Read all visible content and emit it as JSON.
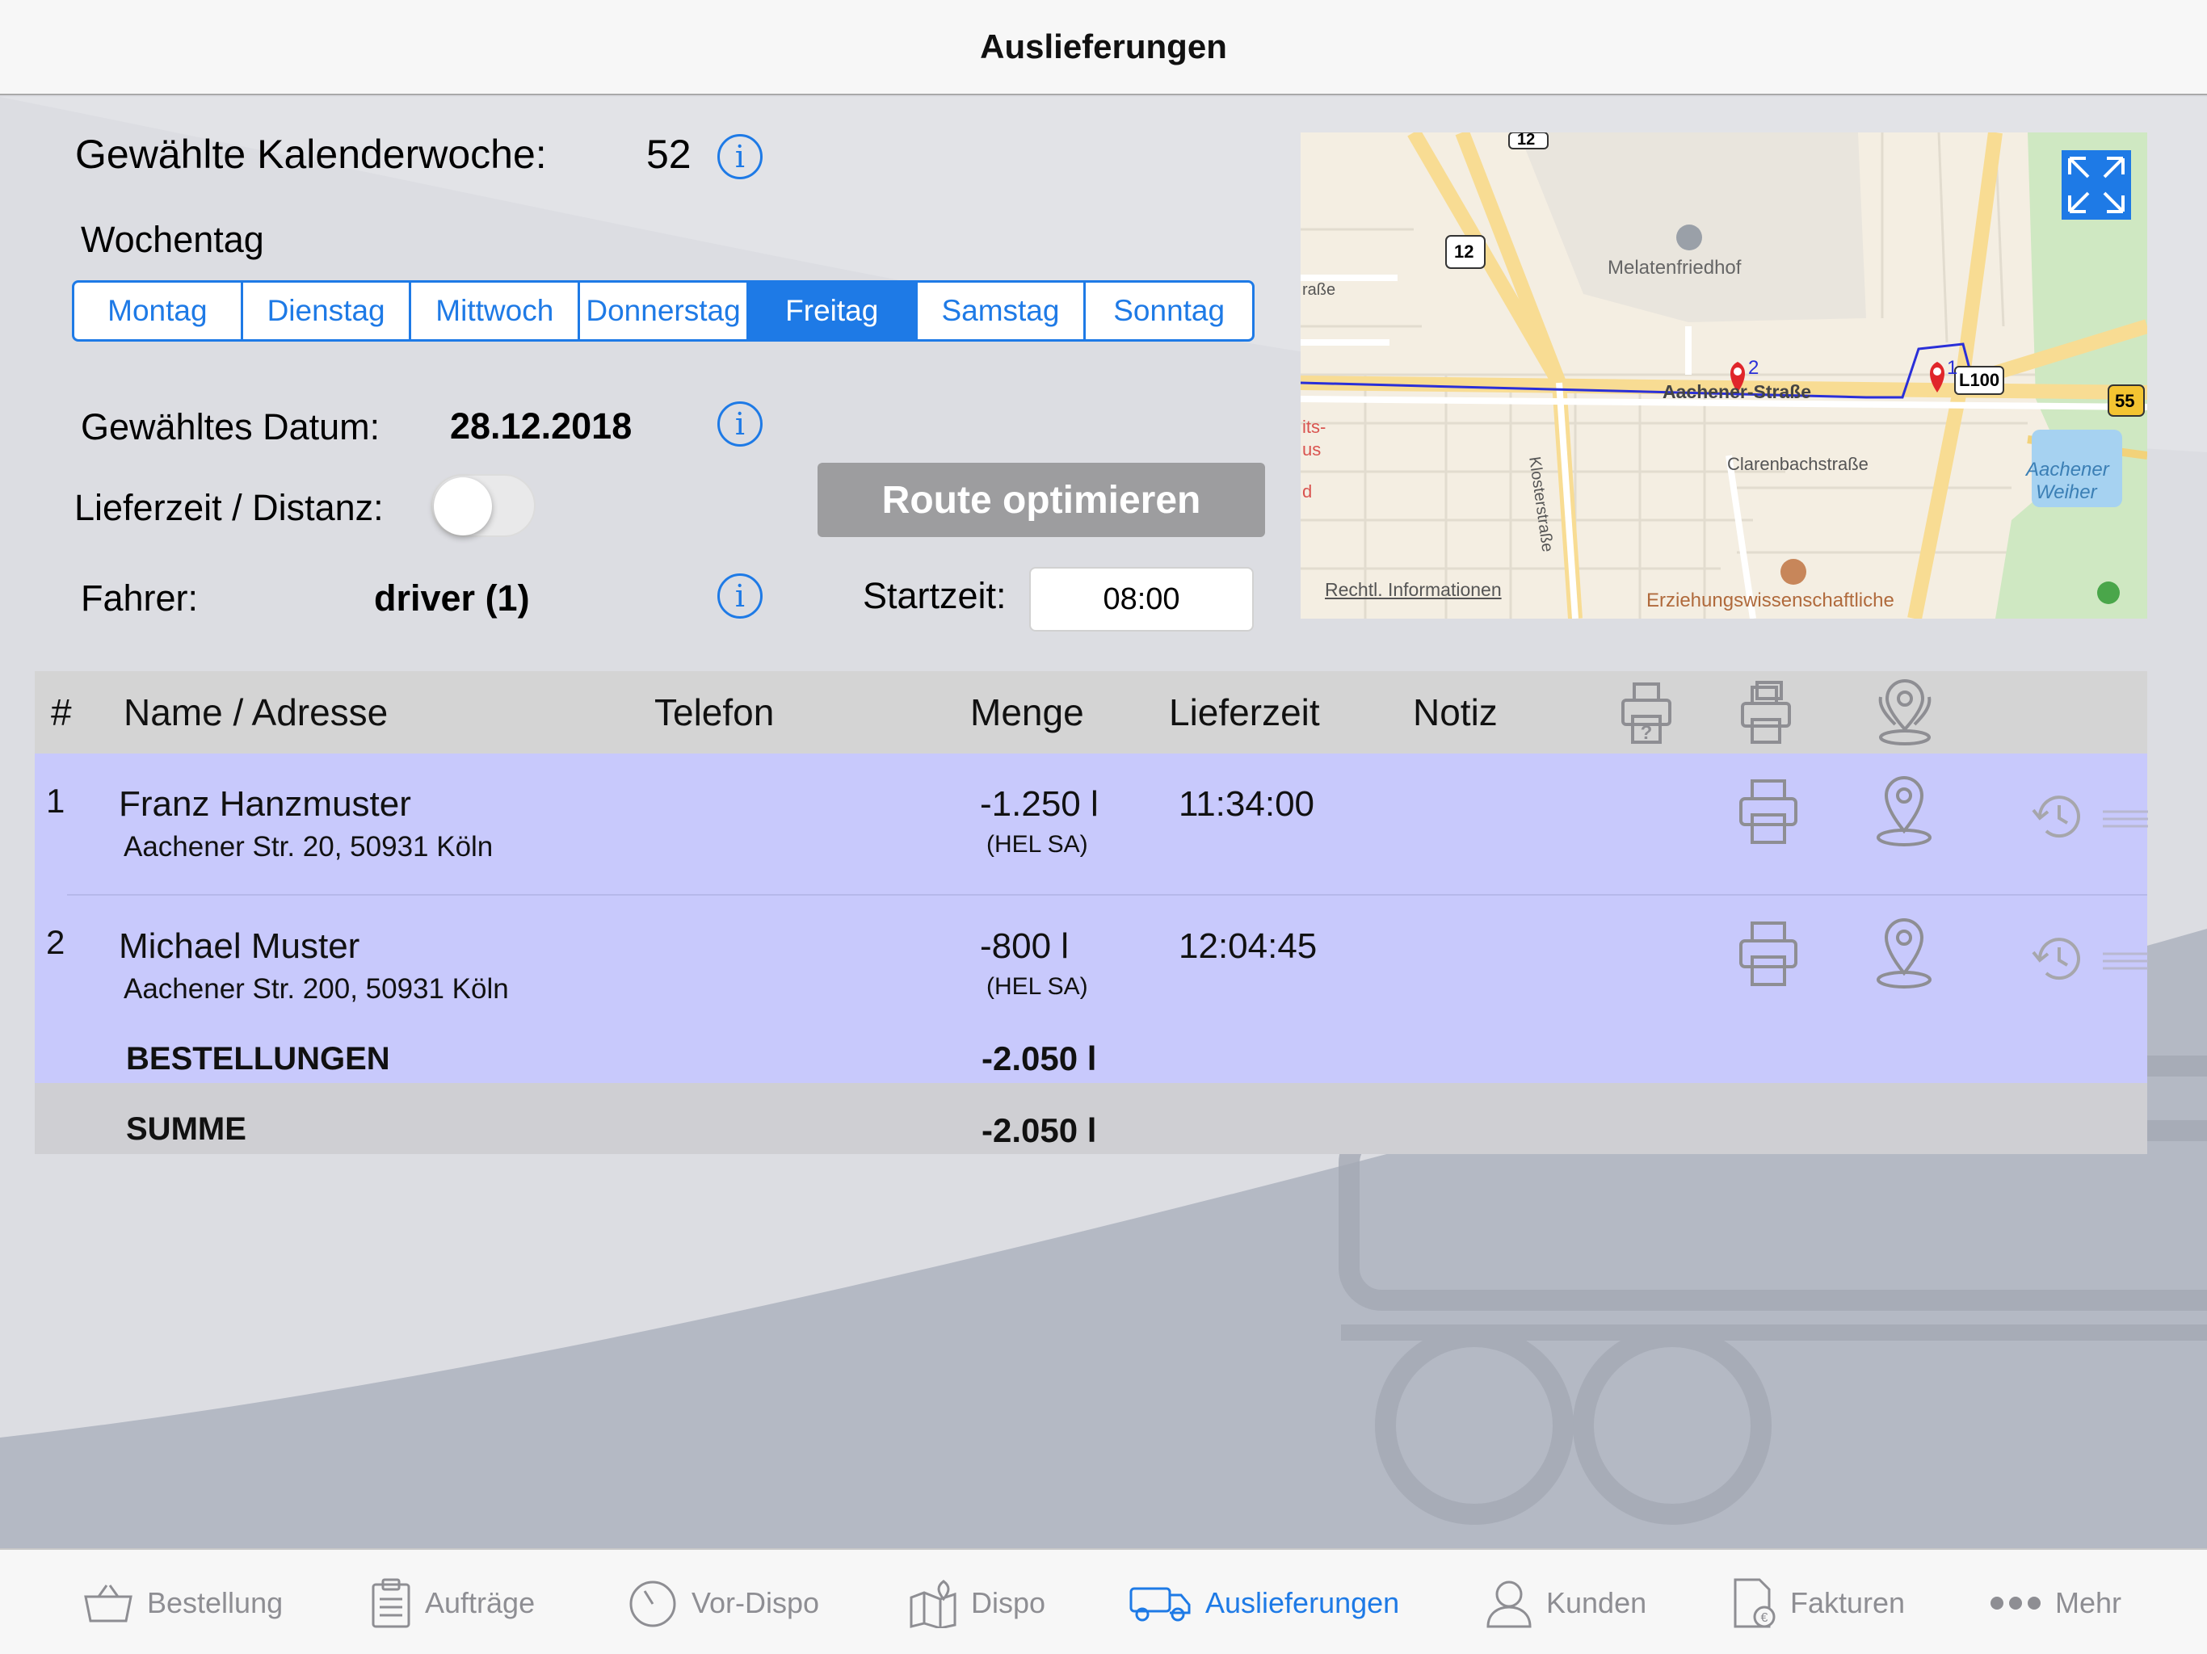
{
  "nav": {
    "title": "Auslieferungen"
  },
  "week": {
    "label": "Gewählte Kalenderwoche:",
    "value": "52"
  },
  "weekday": {
    "label": "Wochentag",
    "days": [
      "Montag",
      "Dienstag",
      "Mittwoch",
      "Donnerstag",
      "Freitag",
      "Samstag",
      "Sonntag"
    ],
    "selected": "Freitag"
  },
  "date": {
    "label": "Gewähltes Datum:",
    "value": "28.12.2018"
  },
  "toggle": {
    "label": "Lieferzeit / Distanz:",
    "on": false
  },
  "driver": {
    "label": "Fahrer:",
    "value": "driver (1)"
  },
  "route_button": "Route optimieren",
  "start": {
    "label": "Startzeit:",
    "value": "08:00"
  },
  "map": {
    "labels": {
      "melaten": "Melatenfriedhof",
      "aachener_strasse": "Aachener-Straße",
      "kloster": "Klosterstraße",
      "clarenbach": "Clarenbachstraße",
      "weiher_1": "Aachener",
      "weiher_2": "Weiher",
      "erziehung": "Erziehungswissenschaftliche",
      "legal": "Rechtl. Informationen",
      "strasse_left": "raße",
      "its": "its-",
      "us": "us",
      "d": "d",
      "shield_12a": "12",
      "shield_12b": "12",
      "shield_l100": "L100",
      "shield_55": "55",
      "pin_2": "2",
      "pin_1": "1"
    },
    "expand_icon": "expand-icon"
  },
  "table": {
    "headers": {
      "num": "#",
      "name": "Name / Adresse",
      "phone": "Telefon",
      "qty": "Menge",
      "time": "Lieferzeit",
      "note": "Notiz"
    },
    "rows": [
      {
        "num": "1",
        "name": "Franz Hanzmuster",
        "address": "Aachener Str. 20, 50931 Köln",
        "phone": "",
        "qty": "-1.250 l",
        "product": "(HEL SA)",
        "time": "11:34:00",
        "note": ""
      },
      {
        "num": "2",
        "name": "Michael Muster",
        "address": "Aachener Str. 200, 50931 Köln",
        "phone": "",
        "qty": "-800 l",
        "product": "(HEL SA)",
        "time": "12:04:45",
        "note": ""
      }
    ],
    "bestellungen": {
      "label": "BESTELLUNGEN",
      "value": "-2.050 l"
    },
    "summe": {
      "label": "SUMME",
      "value": "-2.050 l"
    }
  },
  "tabbar": {
    "items": [
      {
        "label": "Bestellung",
        "icon": "basket-icon"
      },
      {
        "label": "Aufträge",
        "icon": "clipboard-icon"
      },
      {
        "label": "Vor-Dispo",
        "icon": "stopwatch-icon"
      },
      {
        "label": "Dispo",
        "icon": "map-icon"
      },
      {
        "label": "Auslieferungen",
        "icon": "truck-icon"
      },
      {
        "label": "Kunden",
        "icon": "person-icon"
      },
      {
        "label": "Fakturen",
        "icon": "invoice-icon"
      },
      {
        "label": "Mehr",
        "icon": "more-icon"
      }
    ],
    "active": "Auslieferungen"
  },
  "colors": {
    "accent": "#1e7ae6",
    "row": "#c8c9fc",
    "header": "#d4d4d4",
    "button_disabled": "#9d9d9f",
    "pin": "#e0262a",
    "route": "#2a2fd8"
  }
}
